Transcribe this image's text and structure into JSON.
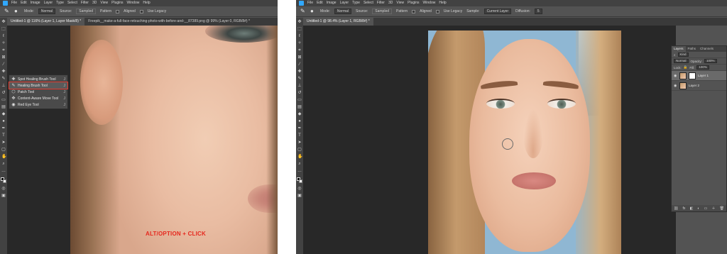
{
  "colors": {
    "accent": "#31a8ff",
    "highlight": "#e03a2f",
    "caption": "#e6281e",
    "ui_bg": "#535353"
  },
  "left": {
    "menu": [
      "File",
      "Edit",
      "Image",
      "Layer",
      "Type",
      "Select",
      "Filter",
      "3D",
      "View",
      "Plugins",
      "Window",
      "Help"
    ],
    "options": {
      "mode_label": "Mode:",
      "mode_value": "Normal",
      "source_label": "Source:",
      "source_value": "Sampled",
      "pattern_label": "Pattern",
      "aligned_label": "Aligned",
      "legacy_label": "Use Legacy"
    },
    "tabs": [
      "Untitled-1 @ 116% (Layer 1, Layer Mask/8) *",
      "Freepik__make-a-full-face-retouching-photo-with-before-and-__87389.png @ 99% (Layer 0, RGB/8#) *"
    ],
    "flyout": [
      {
        "icon": "spot-healing-icon",
        "label": "Spot Healing Brush Tool",
        "key": "J",
        "selected": false
      },
      {
        "icon": "healing-brush-icon",
        "label": "Healing Brush Tool",
        "key": "J",
        "selected": true
      },
      {
        "icon": "patch-icon",
        "label": "Patch Tool",
        "key": "J",
        "selected": false
      },
      {
        "icon": "content-aware-move-icon",
        "label": "Content-Aware Move Tool",
        "key": "J",
        "selected": false
      },
      {
        "icon": "red-eye-icon",
        "label": "Red Eye Tool",
        "key": "J",
        "selected": false
      }
    ],
    "caption": "ALT/OPTION + CLICK"
  },
  "right": {
    "menu": [
      "File",
      "Edit",
      "Image",
      "Layer",
      "Type",
      "Select",
      "Filter",
      "3D",
      "View",
      "Plugins",
      "Window",
      "Help"
    ],
    "options": {
      "mode_label": "Mode:",
      "mode_value": "Normal",
      "source_label": "Source:",
      "source_value": "Sampled",
      "pattern_label": "Pattern",
      "aligned_label": "Aligned",
      "legacy_label": "Use Legacy",
      "sample_label": "Sample:",
      "sample_value": "Current Layer",
      "diffusion_label": "Diffusion:",
      "diffusion_value": "5"
    },
    "tab": "Untitled-1 @ 98.4% (Layer 1, RGB/8#) *",
    "panel": {
      "tabs": [
        "Layers",
        "Paths",
        "Channels"
      ],
      "kind_label": "Kind",
      "blend_value": "Normal",
      "opacity_label": "Opacity:",
      "opacity_value": "100%",
      "lock_label": "Lock:",
      "fill_label": "Fill:",
      "fill_value": "100%",
      "layers": [
        {
          "name": "Layer 1",
          "has_mask": true,
          "active": true
        },
        {
          "name": "Layer 2",
          "has_mask": false,
          "active": false
        }
      ]
    }
  }
}
